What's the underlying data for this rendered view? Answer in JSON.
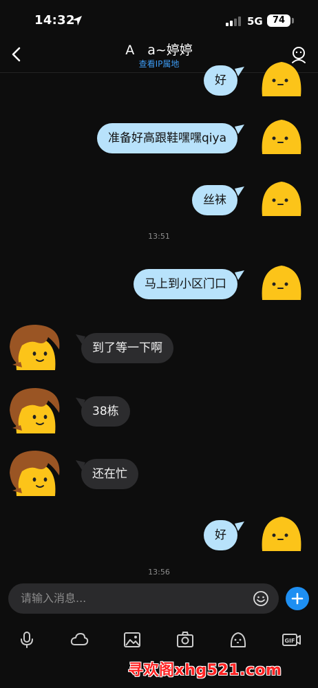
{
  "status_bar": {
    "time": "14:32",
    "network": "5G",
    "battery": "74"
  },
  "header": {
    "title": "A　a~婷婷",
    "subtitle": "查看IP属地"
  },
  "messages": [
    {
      "side": "out",
      "text": "好"
    },
    {
      "side": "out",
      "text": "准备好高跟鞋嘿嘿qiya"
    },
    {
      "side": "out",
      "text": "丝袜"
    },
    {
      "side": "time",
      "text": "13:51"
    },
    {
      "side": "out",
      "text": "马上到小区门口"
    },
    {
      "side": "in",
      "text": "到了等一下啊"
    },
    {
      "side": "in",
      "text": "38栋"
    },
    {
      "side": "in",
      "text": "还在忙"
    },
    {
      "side": "out",
      "text": "好"
    },
    {
      "side": "time",
      "text": "13:56"
    }
  ],
  "input": {
    "placeholder": "请输入消息..."
  },
  "toolbar": [
    "microphone-icon",
    "cloud-icon",
    "image-icon",
    "camera-icon",
    "sticker-face-icon",
    "gif-icon"
  ],
  "watermark": "寻欢阁xhg521.com",
  "colors": {
    "outgoing_bubble": "#b8e2fb",
    "incoming_bubble": "#2c2c2e",
    "accent": "#1e8ff2",
    "avatar_yellow": "#fcc419",
    "hair_brown": "#9a5524"
  }
}
